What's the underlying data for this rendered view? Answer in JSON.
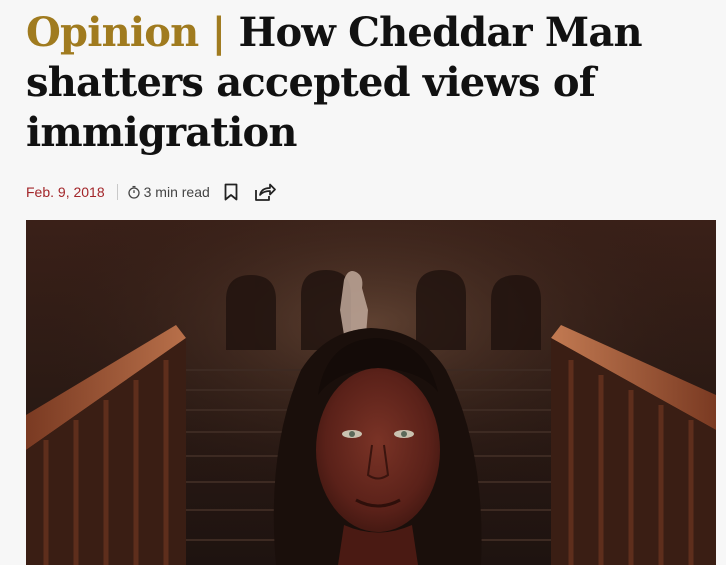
{
  "article": {
    "kicker": "Opinion |",
    "title": "How Cheddar Man shatters accepted views of immigration",
    "date": "Feb. 9, 2018",
    "read_time": "3 min read"
  },
  "icons": {
    "read_time": "stopwatch-icon",
    "bookmark": "bookmark-icon",
    "share": "share-icon"
  },
  "colors": {
    "kicker": "#a07b1f",
    "date": "#a3262a",
    "headline": "#111111",
    "background": "#f7f7f7"
  }
}
